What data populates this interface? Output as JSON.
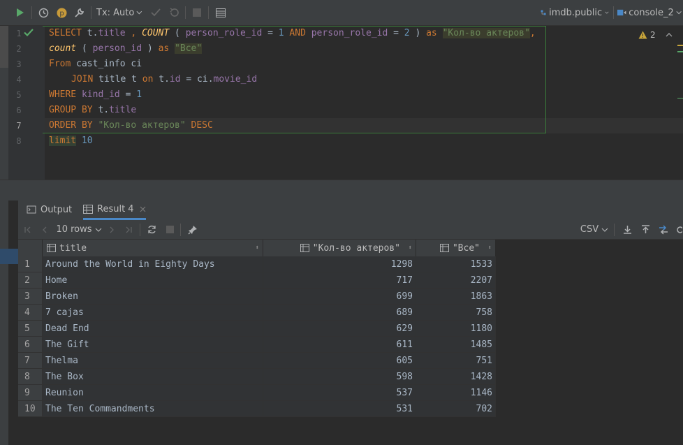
{
  "toolbar": {
    "tx_mode": "Tx: Auto",
    "schema": "imdb.public",
    "console": "console_2"
  },
  "editor": {
    "line_numbers": [
      "1",
      "2",
      "3",
      "4",
      "5",
      "6",
      "7",
      "8"
    ],
    "warnings_count": "2",
    "sql": {
      "l1_kw1": "SELECT",
      "l1_t": " t.",
      "l1_title": "title",
      "l1_comma": " , ",
      "l1_count": "COUNT",
      "l1_p1": " ( ",
      "l1_f1": "person_role_id",
      "l1_eq1": " = ",
      "l1_n1": "1",
      "l1_and": " AND ",
      "l1_f2": "person_role_id",
      "l1_eq2": " = ",
      "l1_n2": "2",
      "l1_p2": " ) ",
      "l1_as": "as",
      "l1_sp": " ",
      "l1_alias": "\"Кол-во актеров\"",
      "l1_end": ",",
      "l2_count": "count",
      "l2_p1": " ( ",
      "l2_f": "person_id",
      "l2_p2": " ) ",
      "l2_as": "as",
      "l2_sp": " ",
      "l2_alias": "\"Все\"",
      "l3_from": "From",
      "l3_rest": " cast_info ci",
      "l4_join": "JOIN",
      "l4_a": " title t ",
      "l4_on": "on",
      "l4_b": " t.",
      "l4_id": "id",
      "l4_c": " = ci.",
      "l4_mid": "movie_id",
      "l5_where": "WHERE",
      "l5_sp": " ",
      "l5_f": "kind_id",
      "l5_eq": " = ",
      "l5_n": "1",
      "l6_group": "GROUP BY",
      "l6_a": " t.",
      "l6_f": "title",
      "l7_order": "ORDER BY",
      "l7_sp": " ",
      "l7_alias": "\"Кол-во актеров\"",
      "l7_sp2": " ",
      "l7_desc": "DESC",
      "l8_limit": "limit",
      "l8_sp": " ",
      "l8_n": "10"
    }
  },
  "tabs": {
    "output": "Output",
    "result": "Result 4"
  },
  "results_toolbar": {
    "rows": "10 rows",
    "export_format": "CSV"
  },
  "grid": {
    "columns": [
      "title",
      "\"Кол-во актеров\"",
      "\"Все\""
    ],
    "rows": [
      {
        "n": "1",
        "title": "Around the World in Eighty Days",
        "actors": "1298",
        "all": "1533"
      },
      {
        "n": "2",
        "title": "Home",
        "actors": "717",
        "all": "2207"
      },
      {
        "n": "3",
        "title": "Broken",
        "actors": "699",
        "all": "1863"
      },
      {
        "n": "4",
        "title": "7 cajas",
        "actors": "689",
        "all": "758"
      },
      {
        "n": "5",
        "title": "Dead End",
        "actors": "629",
        "all": "1180"
      },
      {
        "n": "6",
        "title": "The Gift",
        "actors": "611",
        "all": "1485"
      },
      {
        "n": "7",
        "title": "Thelma",
        "actors": "605",
        "all": "751"
      },
      {
        "n": "8",
        "title": "The Box",
        "actors": "598",
        "all": "1428"
      },
      {
        "n": "9",
        "title": "Reunion",
        "actors": "537",
        "all": "1146"
      },
      {
        "n": "10",
        "title": "The Ten Commandments",
        "actors": "531",
        "all": "702"
      }
    ]
  },
  "colors": {
    "keyword": "#cc7832",
    "field": "#9876aa",
    "number": "#6897bb",
    "string": "#6a8759",
    "run_green": "#59a869",
    "accent_blue": "#4a88c7"
  }
}
